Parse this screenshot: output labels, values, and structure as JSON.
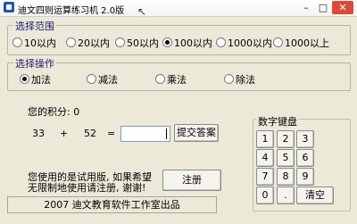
{
  "window": {
    "title": "迪文四则运算练习机 2.0版"
  },
  "range": {
    "label": "选择范围",
    "options": [
      "10以内",
      "20以内",
      "50以内",
      "100以内",
      "1000以内",
      "1000以上"
    ],
    "selected": "100以内"
  },
  "operation": {
    "label": "选择操作",
    "options": [
      "加法",
      "减法",
      "乘法",
      "除法"
    ],
    "selected": "加法"
  },
  "score": {
    "label": "您的积分: 0"
  },
  "question": {
    "operand1": "33",
    "operator": "+",
    "operand2": "52",
    "equals": "="
  },
  "answer": {
    "value": ""
  },
  "submit_label": "提交答案",
  "trial": {
    "line1": "您使用的是试用版, 如果希望",
    "line2": "无限制地使用请注册, 谢谢!"
  },
  "register_label": "注册",
  "keypad": {
    "label": "数字键盘",
    "keys": [
      "1",
      "2",
      "3",
      "4",
      "5",
      "6",
      "7",
      "8",
      "9",
      "0",
      "."
    ],
    "clear_label": "清空"
  },
  "status": {
    "text": "2007 迪文教育软件工作室出品"
  }
}
